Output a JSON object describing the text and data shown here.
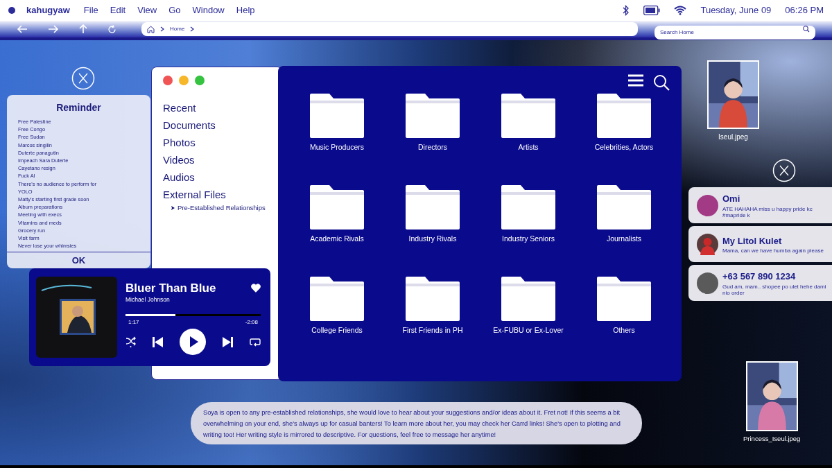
{
  "menu_bar": {
    "app_name": "kahugyaw",
    "menus": [
      "File",
      "Edit",
      "View",
      "Go",
      "Window",
      "Help"
    ],
    "date": "Tuesday, June 09",
    "time": "06:26 PM"
  },
  "toolbar": {
    "breadcrumb": [
      "Home"
    ],
    "search": {
      "placeholder": "Search Home"
    }
  },
  "reminder": {
    "title": "Reminder",
    "items": [
      "Free Palestine",
      "Free Congo",
      "Free Sudan",
      "Marcos singilin",
      "Duterte panagutin",
      "Impeach Sara Duterte",
      "Cayetano resign",
      "Fuck AI",
      "There's no audience to perform for",
      "YOLO",
      "Matty's starting first grade soon",
      "Album preparations",
      "Meeting with execs",
      "Vitamins and meds",
      "Grocery run",
      "Visit farm",
      "Never lose your whimsies"
    ],
    "button": "OK"
  },
  "sidebar": {
    "items": [
      {
        "label": "Recent"
      },
      {
        "label": "Documents"
      },
      {
        "label": "Photos"
      },
      {
        "label": "Videos"
      },
      {
        "label": "Audios"
      },
      {
        "label": "External Files",
        "children": [
          {
            "label": "Pre-Established Relationships"
          }
        ]
      }
    ]
  },
  "folders": [
    "Music Producers",
    "Directors",
    "Artists",
    "Celebrities, Actors",
    "Academic Rivals",
    "Industry Rivals",
    "Industry Seniors",
    "Journalists",
    "College Friends",
    "First Friends in PH",
    "Ex-FUBU or Ex-Lover",
    "Others"
  ],
  "player": {
    "title": "Bluer Than Blue",
    "artist": "Michael Johnson",
    "level": 0.37,
    "elapsed": "1:17",
    "remaining": "-2:08",
    "liked": true
  },
  "desktop_files": [
    {
      "name": "Iseul.jpeg"
    },
    {
      "name": "Princess_Iseul.jpeg"
    }
  ],
  "notifications": [
    {
      "sender": "Omi",
      "message": "ATE HAHAHA miss u happy pride kc #mapride k",
      "avatar": {
        "kind": "color",
        "color": "#a23a86"
      }
    },
    {
      "sender": "My Litol Kulet",
      "message": "Mama, can we have humba again please"
    },
    {
      "sender": "+63 567 890 1234",
      "message": "Gud am, mam.. shopee po ulet hehe dami nio order",
      "avatar": {
        "kind": "color",
        "color": "#5a5a5a"
      }
    }
  ],
  "caption": "Soya is open to any pre-established relationships, she would love to hear about your suggestions and/or ideas about it. Fret not! If this seems a bit overwhelming on your end, she's always up for casual banters! To learn more about her, you may check her Carrd links! She's open to plotting and writing too! Her writing style is mirrored to descriptive. For questions, feel free to message her anytime!"
}
